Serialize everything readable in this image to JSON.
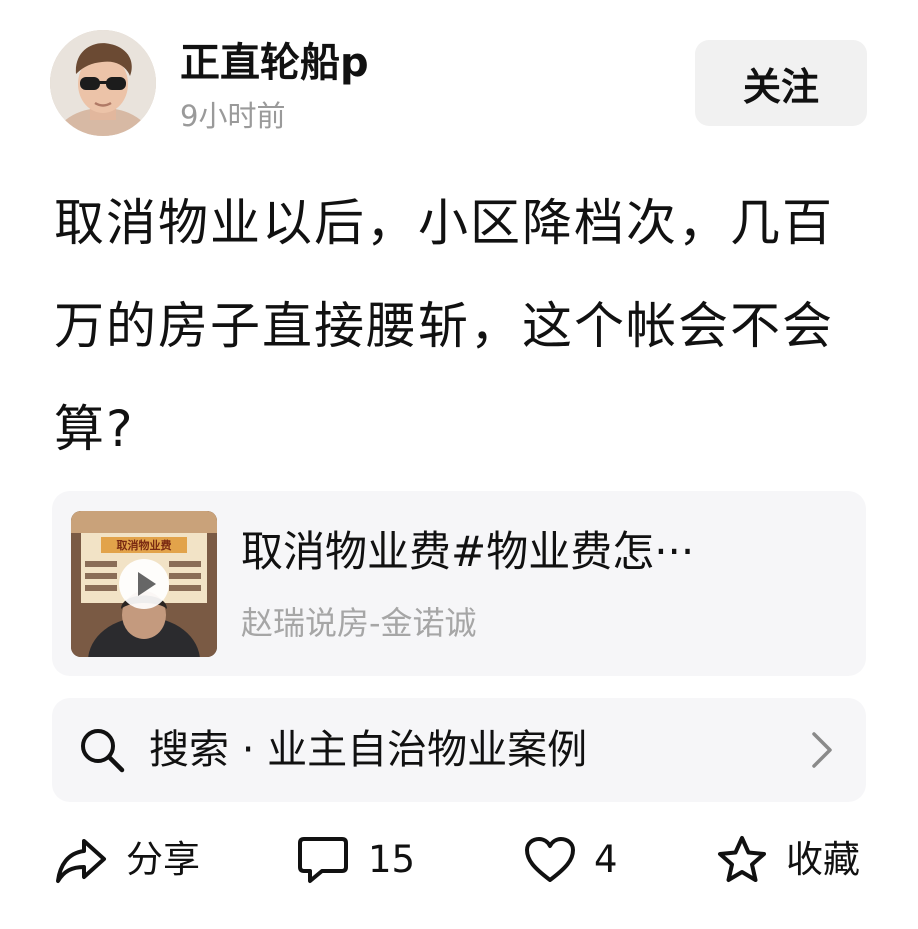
{
  "author": {
    "name": "正直轮船p",
    "time": "9小时前",
    "avatar_icon": "avatar-man-sunglasses"
  },
  "follow_button": {
    "label": "关注"
  },
  "post": {
    "text": "取消物业以后，小区降档次，几百万的房子直接腰斩，这个帐会不会算?"
  },
  "video": {
    "title": "取消物业费#物业费怎···",
    "author": "赵瑞说房-金诺诚",
    "thumbnail_icon": "video-thumbnail",
    "thumbnail_text": "取消物业费"
  },
  "search": {
    "text": "搜索 · 业主自治物业案例",
    "icon": "search-icon",
    "trailing_icon": "chevron-right-icon"
  },
  "actions": {
    "share_label": "分享",
    "comment_count": "15",
    "like_count": "4",
    "collect_label": "收藏"
  }
}
